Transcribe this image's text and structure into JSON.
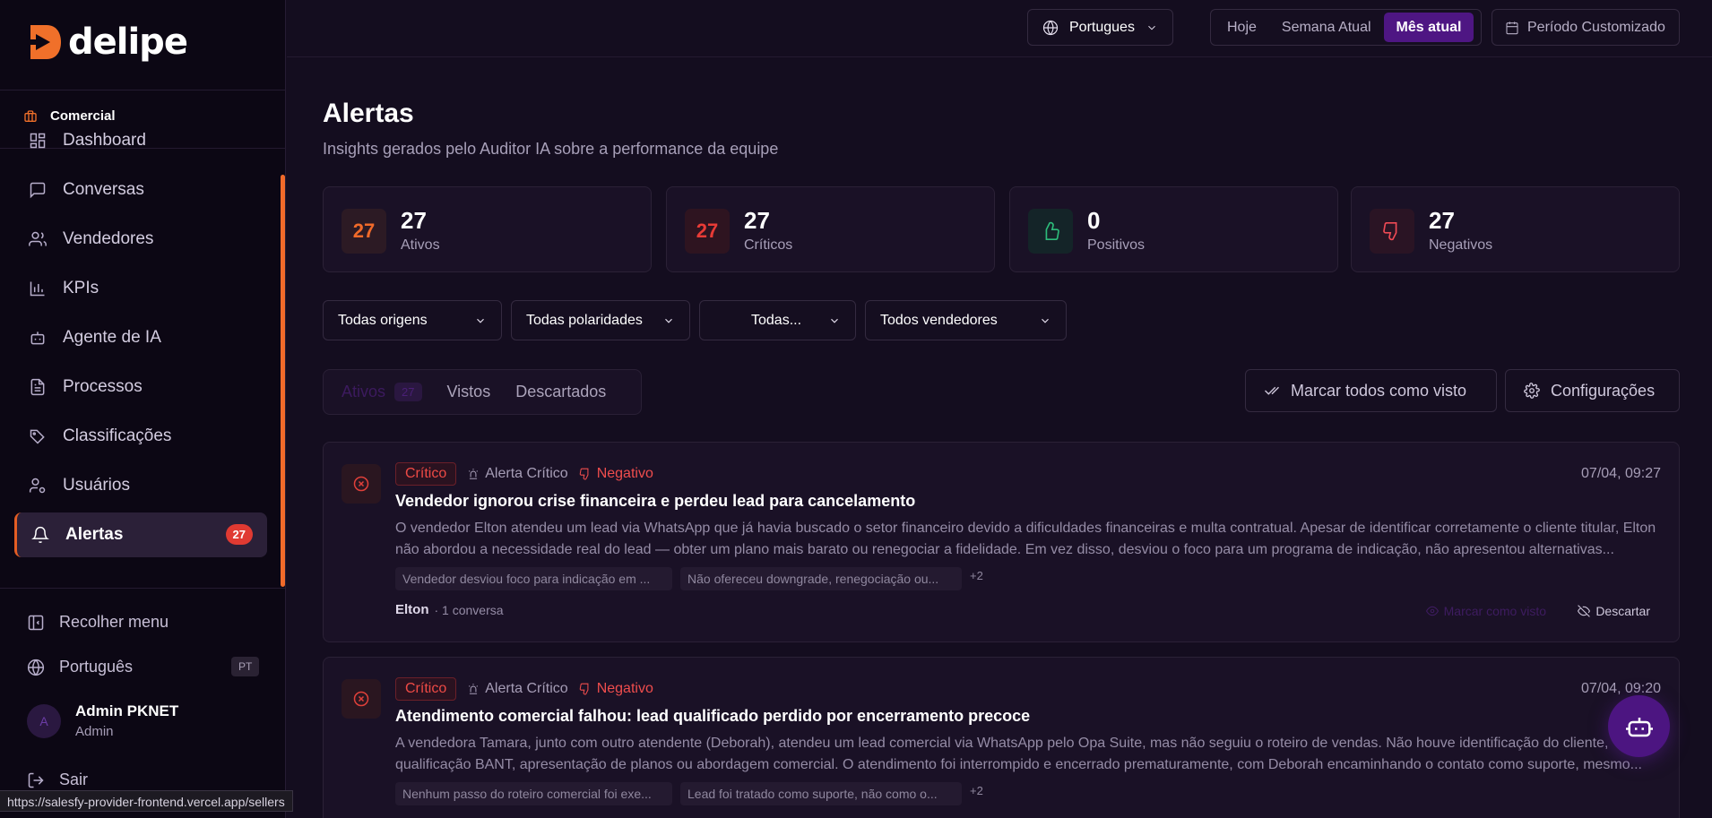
{
  "app": {
    "logo_text": "delipe"
  },
  "sidebar": {
    "section": "Comercial",
    "items": [
      {
        "label": "Dashboard",
        "icon": "dashboard-icon"
      },
      {
        "label": "Conversas",
        "icon": "chat-icon"
      },
      {
        "label": "Vendedores",
        "icon": "users-icon"
      },
      {
        "label": "KPIs",
        "icon": "bar-chart-icon"
      },
      {
        "label": "Agente de IA",
        "icon": "bot-icon"
      },
      {
        "label": "Processos",
        "icon": "document-icon"
      },
      {
        "label": "Classificações",
        "icon": "tags-icon"
      },
      {
        "label": "Usuários",
        "icon": "user-cog-icon"
      },
      {
        "label": "Alertas",
        "icon": "bell-icon",
        "badge": "27",
        "active": true
      }
    ],
    "collapse_label": "Recolher menu",
    "language_label": "Português",
    "language_code": "PT",
    "user": {
      "initial": "A",
      "name": "Admin PKNET",
      "role": "Admin"
    },
    "logout_label": "Sair"
  },
  "status_url": "https://salesfy-provider-frontend.vercel.app/sellers",
  "topbar": {
    "language": "Portugues",
    "periods": [
      "Hoje",
      "Semana Atual",
      "Mês atual"
    ],
    "active_period": "Mês atual",
    "custom_period": "Período Customizado"
  },
  "page": {
    "title": "Alertas",
    "subtitle": "Insights gerados pelo Auditor IA sobre a performance da equipe"
  },
  "stats": [
    {
      "icon_text": "27",
      "value": "27",
      "label": "Ativos"
    },
    {
      "icon_text": "27",
      "value": "27",
      "label": "Críticos"
    },
    {
      "icon": "thumbs-up-icon",
      "value": "0",
      "label": "Positivos"
    },
    {
      "icon": "thumbs-down-icon",
      "value": "27",
      "label": "Negativos"
    }
  ],
  "filters": {
    "origin": "Todas origens",
    "polarity": "Todas polaridades",
    "type": "Todas...",
    "sellers": "Todos vendedores"
  },
  "tabs": [
    {
      "label": "Ativos",
      "count": "27"
    },
    {
      "label": "Vistos"
    },
    {
      "label": "Descartados"
    }
  ],
  "actions": {
    "mark_all": "Marcar todos como visto",
    "settings": "Configurações"
  },
  "alerts": [
    {
      "severity": "Crítico",
      "type": "Alerta Crítico",
      "polarity": "Negativo",
      "time": "07/04, 09:27",
      "title": "Vendedor ignorou crise financeira e perdeu lead para cancelamento",
      "description": "O vendedor Elton atendeu um lead via WhatsApp que já havia buscado o setor financeiro devido a dificuldades financeiras e multa contratual. Apesar de identificar corretamente o cliente titular, Elton não abordou a necessidade real do lead — obter um plano mais barato ou renegociar a fidelidade. Em vez disso, desviou o foco para um programa de indicação, não apresentou alternativas...",
      "tags": [
        "Vendedor desviou foco para indicação em ...",
        "Não ofereceu downgrade, renegociação ou..."
      ],
      "more": "+2",
      "seller": "Elton",
      "conversations": "· 1 conversa",
      "mark_seen": "Marcar como visto",
      "discard": "Descartar"
    },
    {
      "severity": "Crítico",
      "type": "Alerta Crítico",
      "polarity": "Negativo",
      "time": "07/04, 09:20",
      "title": "Atendimento comercial falhou: lead qualificado perdido por encerramento precoce",
      "description": "A vendedora Tamara, junto com outro atendente (Deborah), atendeu um lead comercial via WhatsApp pelo Opa Suite, mas não seguiu o roteiro de vendas. Não houve identificação do cliente, qualificação BANT, apresentação de planos ou abordagem comercial. O atendimento foi interrompido e encerrado prematuramente, com Deborah encaminhando o contato como suporte, mesmo...",
      "tags": [
        "Nenhum passo do roteiro comercial foi exe...",
        "Lead foi tratado como suporte, não como o..."
      ],
      "more": "+2"
    }
  ]
}
